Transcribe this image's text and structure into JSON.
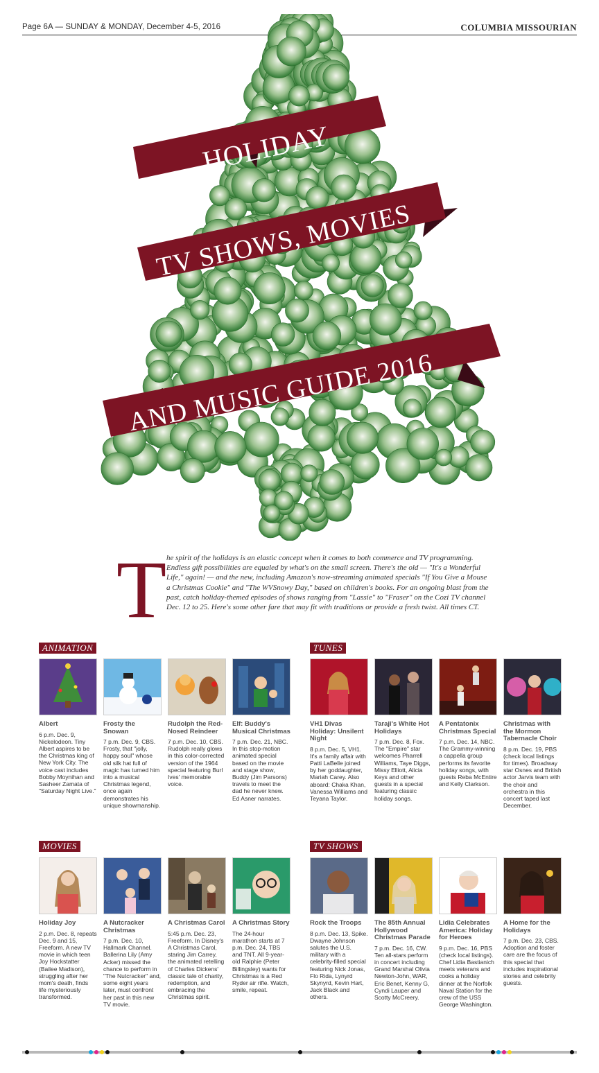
{
  "folio": {
    "left": "Page 6A — SUNDAY & MONDAY, December 4-5, 2016",
    "right": "COLUMBIA MISSOURIAN"
  },
  "hero": {
    "banner1": "HOLIDAY",
    "banner2": "TV SHOWS, MOVIES",
    "banner3": "AND MUSIC GUIDE 2016",
    "colors": {
      "banner": "#7d1424",
      "banner_fold": "#3a0b16",
      "tree_green": "#3e8b3e",
      "tree_light": "#e8efe0"
    }
  },
  "intro": {
    "dropcap": "T",
    "text": "he spirit of the holidays is an elastic concept when it comes to both commerce and TV programming. Endless gift possibilities are equaled by what's on the small screen. There's the old — \"It's a Wonderful Life,\" again! — and the new, including Amazon's now-streaming animated specials \"If You Give a Mouse a Christmas Cookie\" and \"The WVSnowy Day,\" based on children's books. For an ongoing blast from the past, catch holiday-themed episodes of shows ranging from \"Lassie\" to \"Fraser\" on the Cozi TV channel Dec. 12 to 25. Here's some other fare that may fit with traditions or provide a fresh twist. All times CT."
  },
  "sections": {
    "animation": {
      "label": "ANIMATION",
      "items": [
        {
          "title": "Albert",
          "body": "6 p.m. Dec. 9, Nickelodeon. Tiny Albert aspires to be the Christmas king of New York City. The voice cast includes Bobby Moynihan and Sasheer Zamata of \"Saturday Night Live.\"",
          "image": "albert-tree-image"
        },
        {
          "title": "Frosty the Snowan",
          "body": "7 p.m. Dec. 9, CBS. Frosty, that \"jolly, happy soul\" whose old silk hat full of magic has turned him into a musical Christmas legend, once again demonstrates his unique showmanship.",
          "image": "frosty-image"
        },
        {
          "title": "Rudolph the Red-Nosed Reindeer",
          "body": "7 p.m. Dec. 10, CBS. Rudolph really glows in this color-corrected version of the 1964 special featuring Burl Ives' memorable voice.",
          "image": "rudolph-image"
        },
        {
          "title": "Elf: Buddy's Musical Christmas",
          "body": "7 p.m. Dec. 21, NBC. In this stop-motion animated special based on the movie and stage show, Buddy (Jim Parsons) travels to meet the dad he never knew. Ed Asner narrates.",
          "image": "elf-image"
        }
      ]
    },
    "tunes": {
      "label": "TUNES",
      "items": [
        {
          "title": "VH1 Divas Holiday: Unsilent Night",
          "body": "8 p.m. Dec. 5, VH1. It's a family affair with Patti LaBelle joined by her goddaughter, Mariah Carey. Also aboard: Chaka Khan, Vanessa Williams and Teyana Taylor.",
          "image": "divas-image"
        },
        {
          "title": "Taraji's White Hot Holidays",
          "body": "7 p.m. Dec. 8, Fox. The \"Empire\" star welcomes Pharrell Williams, Taye Diggs, Missy Elliott, Alicia Keys and other guests in a special featuring classic holiday songs.",
          "image": "taraji-image"
        },
        {
          "title": "A Pentatonix Christmas Special",
          "body": "7 p.m. Dec. 14, NBC. The Grammy-winning a cappella group performs its favorite holiday songs, with guests Reba McEntire and Kelly Clarkson.",
          "image": "pentatonix-image"
        },
        {
          "title": "Christmas with the Mormon Tabernacle Choir",
          "body": "8 p.m. Dec. 19, PBS (check local listings for times). Broadway star Osnes and British actor Jarvis team with the choir and orchestra in this concert taped last December.",
          "image": "choir-image"
        }
      ]
    },
    "movies": {
      "label": "MOVIES",
      "items": [
        {
          "title": "Holiday Joy",
          "body": "2 p.m. Dec. 8, repeats Dec. 9 and 15, Freeform. A new TV movie in which teen Joy Hockstatter (Bailee Madison), struggling after her mom's death, finds life mysteriously transformed.",
          "image": "holiday-joy-image"
        },
        {
          "title": "A Nutcracker Christmas",
          "body": "7 p.m. Dec. 10, Hallmark Channel. Ballerina Lily (Amy Acker) missed the chance to perform in \"The Nutcracker\" and, some eight years later, must confront her past in this new TV movie.",
          "image": "nutcracker-image"
        },
        {
          "title": "A Christmas Carol",
          "body": "5:45 p.m. Dec. 23, Freeform. In Disney's A Christmas Carol, staring Jim Carrey, the animated retelling of Charles Dickens' classic tale of charity, redemption, and embracing the Christmas spirit.",
          "image": "christmas-carol-image"
        },
        {
          "title": "A Christmas Story",
          "body": "The 24-hour marathon starts at 7 p.m. Dec. 24, TBS and TNT. All 9-year-old Ralphie (Peter Billingsley) wants for Christmas is a Red Ryder air rifle. Watch, smile, repeat.",
          "image": "christmas-story-image"
        }
      ]
    },
    "tvshows": {
      "label": "TV SHOWS",
      "items": [
        {
          "title": "Rock the Troops",
          "body": "8 p.m. Dec. 13, Spike. Dwayne Johnson salutes the U.S. military with a celebrity-filled special featuring Nick Jonas, Flo Rida, Lynyrd Skynyrd, Kevin Hart, Jack Black and others.",
          "image": "rock-troops-image"
        },
        {
          "title": "The 85th Annual Hollywood Christmas Parade",
          "body": "7 p.m. Dec. 16, CW. Ten all-stars perform in concert including Grand Marshal Olivia Newton-John, WAR, Eric Benet, Kenny G, Cyndi Lauper and Scotty McCreery.",
          "image": "parade-image"
        },
        {
          "title": "Lidia Celebrates America: Holiday for Heroes",
          "body": "9 p.m. Dec. 16, PBS (check local listings). Chef Lidia Bastianich meets veterans and cooks a holiday dinner at the Norfolk Naval Station for the crew of the USS George Washington.",
          "image": "lidia-image"
        },
        {
          "title": "A Home for the Holidays",
          "body": "7 p.m. Dec. 23, CBS. Adoption and foster care are the focus of this special that includes inspirational stories and celebrity guests.",
          "image": "home-holidays-image"
        }
      ]
    }
  }
}
